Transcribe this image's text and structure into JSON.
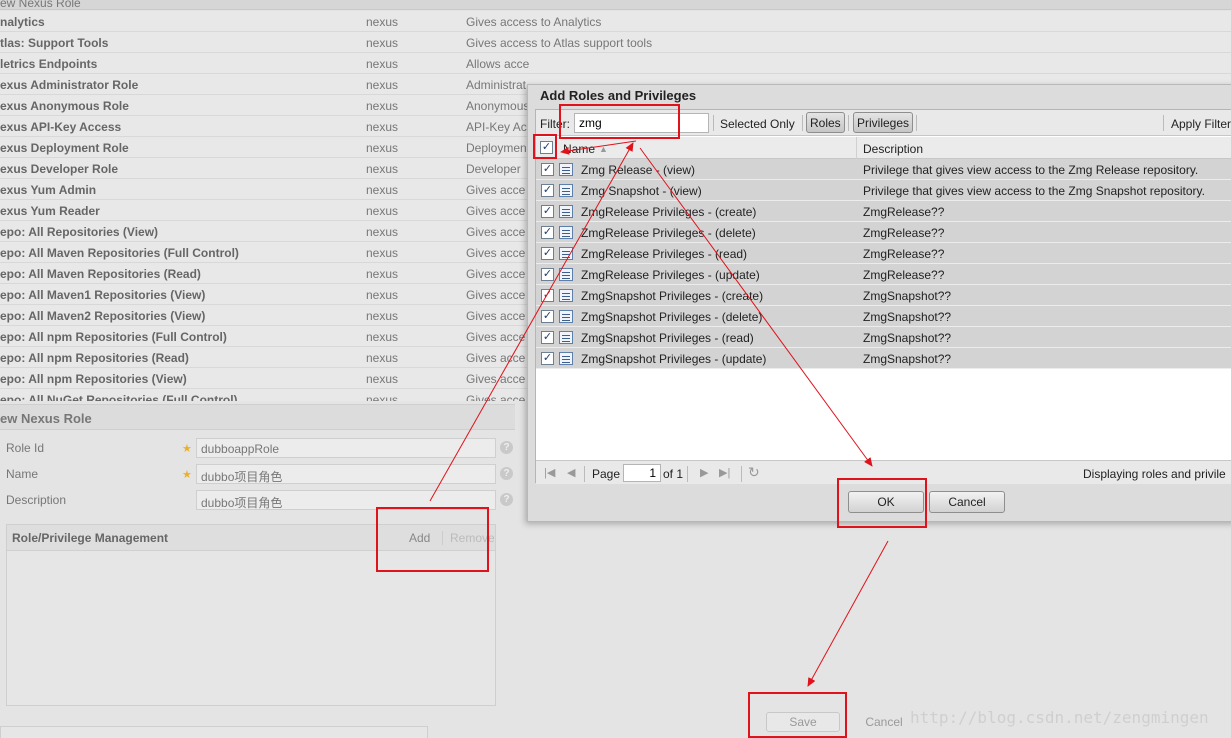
{
  "background": {
    "header_title": "ew Nexus Role",
    "roles": [
      {
        "name": "nalytics",
        "source": "nexus",
        "description": "Gives access to Analytics"
      },
      {
        "name": "tlas: Support Tools",
        "source": "nexus",
        "description": "Gives access to Atlas support tools"
      },
      {
        "name": "letrics Endpoints",
        "source": "nexus",
        "description": "Allows acce"
      },
      {
        "name": "exus Administrator Role",
        "source": "nexus",
        "description": "Administrat"
      },
      {
        "name": "exus Anonymous Role",
        "source": "nexus",
        "description": "Anonymous"
      },
      {
        "name": "exus API-Key Access",
        "source": "nexus",
        "description": "API-Key Acc"
      },
      {
        "name": "exus Deployment Role",
        "source": "nexus",
        "description": "Deploymen"
      },
      {
        "name": "exus Developer Role",
        "source": "nexus",
        "description": "Developer"
      },
      {
        "name": "exus Yum Admin",
        "source": "nexus",
        "description": "Gives acce"
      },
      {
        "name": "exus Yum Reader",
        "source": "nexus",
        "description": "Gives acce"
      },
      {
        "name": "epo: All Repositories (View)",
        "source": "nexus",
        "description": "Gives acce"
      },
      {
        "name": "epo: All Maven Repositories (Full Control)",
        "source": "nexus",
        "description": "Gives acce"
      },
      {
        "name": "epo: All Maven Repositories (Read)",
        "source": "nexus",
        "description": "Gives acce"
      },
      {
        "name": "epo: All Maven1 Repositories (View)",
        "source": "nexus",
        "description": "Gives acce"
      },
      {
        "name": "epo: All Maven2 Repositories (View)",
        "source": "nexus",
        "description": "Gives acce"
      },
      {
        "name": "epo: All npm Repositories (Full Control)",
        "source": "nexus",
        "description": "Gives acce"
      },
      {
        "name": "epo: All npm Repositories (Read)",
        "source": "nexus",
        "description": "Gives acce"
      },
      {
        "name": "epo: All npm Repositories (View)",
        "source": "nexus",
        "description": "Gives acce"
      },
      {
        "name": "epo: All NuGet Repositories (Full Control)",
        "source": "nexus",
        "description": "Gives acce"
      }
    ]
  },
  "form": {
    "title": "ew Nexus Role",
    "role_id_label": "Role Id",
    "role_id_value": "dubboappRole",
    "name_label": "Name",
    "name_value": "dubbo项目角色",
    "description_label": "Description",
    "description_value": "dubbo项目角色",
    "rpm_title": "Role/Privilege Management",
    "add_label": "Add",
    "remove_label": "Remove",
    "save_label": "Save",
    "cancel_label": "Cancel"
  },
  "dialog": {
    "title": "Add Roles and Privileges",
    "filter_label": "Filter:",
    "filter_value": "zmg",
    "selected_only_label": "Selected Only",
    "roles_label": "Roles",
    "privileges_label": "Privileges",
    "apply_filter_label": "Apply Filter",
    "col_name": "Name",
    "col_description": "Description",
    "rows": [
      {
        "name": "Zmg Release - (view)",
        "description": "Privilege that gives view access to the Zmg Release repository.",
        "checked": true
      },
      {
        "name": "Zmg Snapshot - (view)",
        "description": "Privilege that gives view access to the Zmg Snapshot repository.",
        "checked": true
      },
      {
        "name": "ZmgRelease Privileges - (create)",
        "description": "ZmgRelease??",
        "checked": true
      },
      {
        "name": "ZmgRelease Privileges - (delete)",
        "description": "ZmgRelease??",
        "checked": true
      },
      {
        "name": "ZmgRelease Privileges - (read)",
        "description": "ZmgRelease??",
        "checked": true
      },
      {
        "name": "ZmgRelease Privileges - (update)",
        "description": "ZmgRelease??",
        "checked": true
      },
      {
        "name": "ZmgSnapshot Privileges - (create)",
        "description": "ZmgSnapshot??",
        "checked": true
      },
      {
        "name": "ZmgSnapshot Privileges - (delete)",
        "description": "ZmgSnapshot??",
        "checked": true
      },
      {
        "name": "ZmgSnapshot Privileges - (read)",
        "description": "ZmgSnapshot??",
        "checked": true
      },
      {
        "name": "ZmgSnapshot Privileges - (update)",
        "description": "ZmgSnapshot??",
        "checked": true
      }
    ],
    "page_label": "Page",
    "page_value": "1",
    "of_label": "of 1",
    "displaying_label": "Displaying roles and privile",
    "ok_label": "OK",
    "cancel_label": "Cancel"
  },
  "watermark": "http://blog.csdn.net/zengmingen",
  "colors": {
    "annotation": "#e0121b",
    "grid_row": "#d3d3d3",
    "required_star": "#e8b030"
  }
}
